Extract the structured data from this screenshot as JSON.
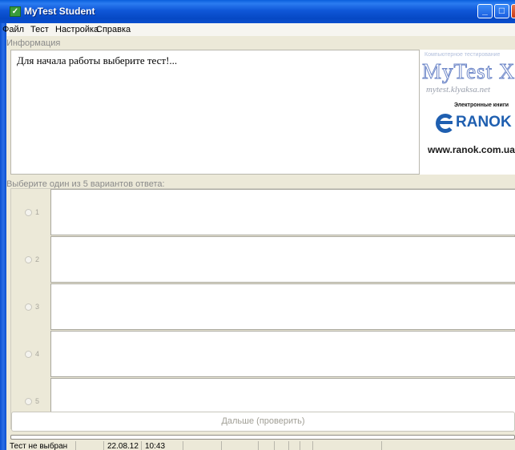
{
  "window": {
    "title": "MyTest Student",
    "icon": "check-icon",
    "controls": [
      "minimize-icon",
      "maximize-icon",
      "close-icon"
    ]
  },
  "menu": [
    "Файл",
    "Тест",
    "Настройка",
    "Справка"
  ],
  "info": {
    "label": "Информация",
    "text": "Для начала работы выберите тест!..."
  },
  "logo": {
    "subtitle": "Компьютерное тестирование",
    "name": "MyTest X",
    "url": "mytest.klyaksa.net",
    "ebooks": "Электронные книги",
    "brand": "RANOK",
    "site": "www.ranok.com.ua"
  },
  "question": {
    "prompt": "Выберите один из 5 вариантов ответа:",
    "options": [
      "1",
      "2",
      "3",
      "4",
      "5"
    ]
  },
  "next_button": "Дальше (проверить)",
  "progress_value": 0,
  "status": {
    "test": "Тест не выбран",
    "date": "22.08.12",
    "time": "10:43"
  },
  "colors": {
    "titlebar": "#0a4fcf",
    "window_bg": "#ece9d8",
    "logo_blue": "#1f5fb0"
  }
}
